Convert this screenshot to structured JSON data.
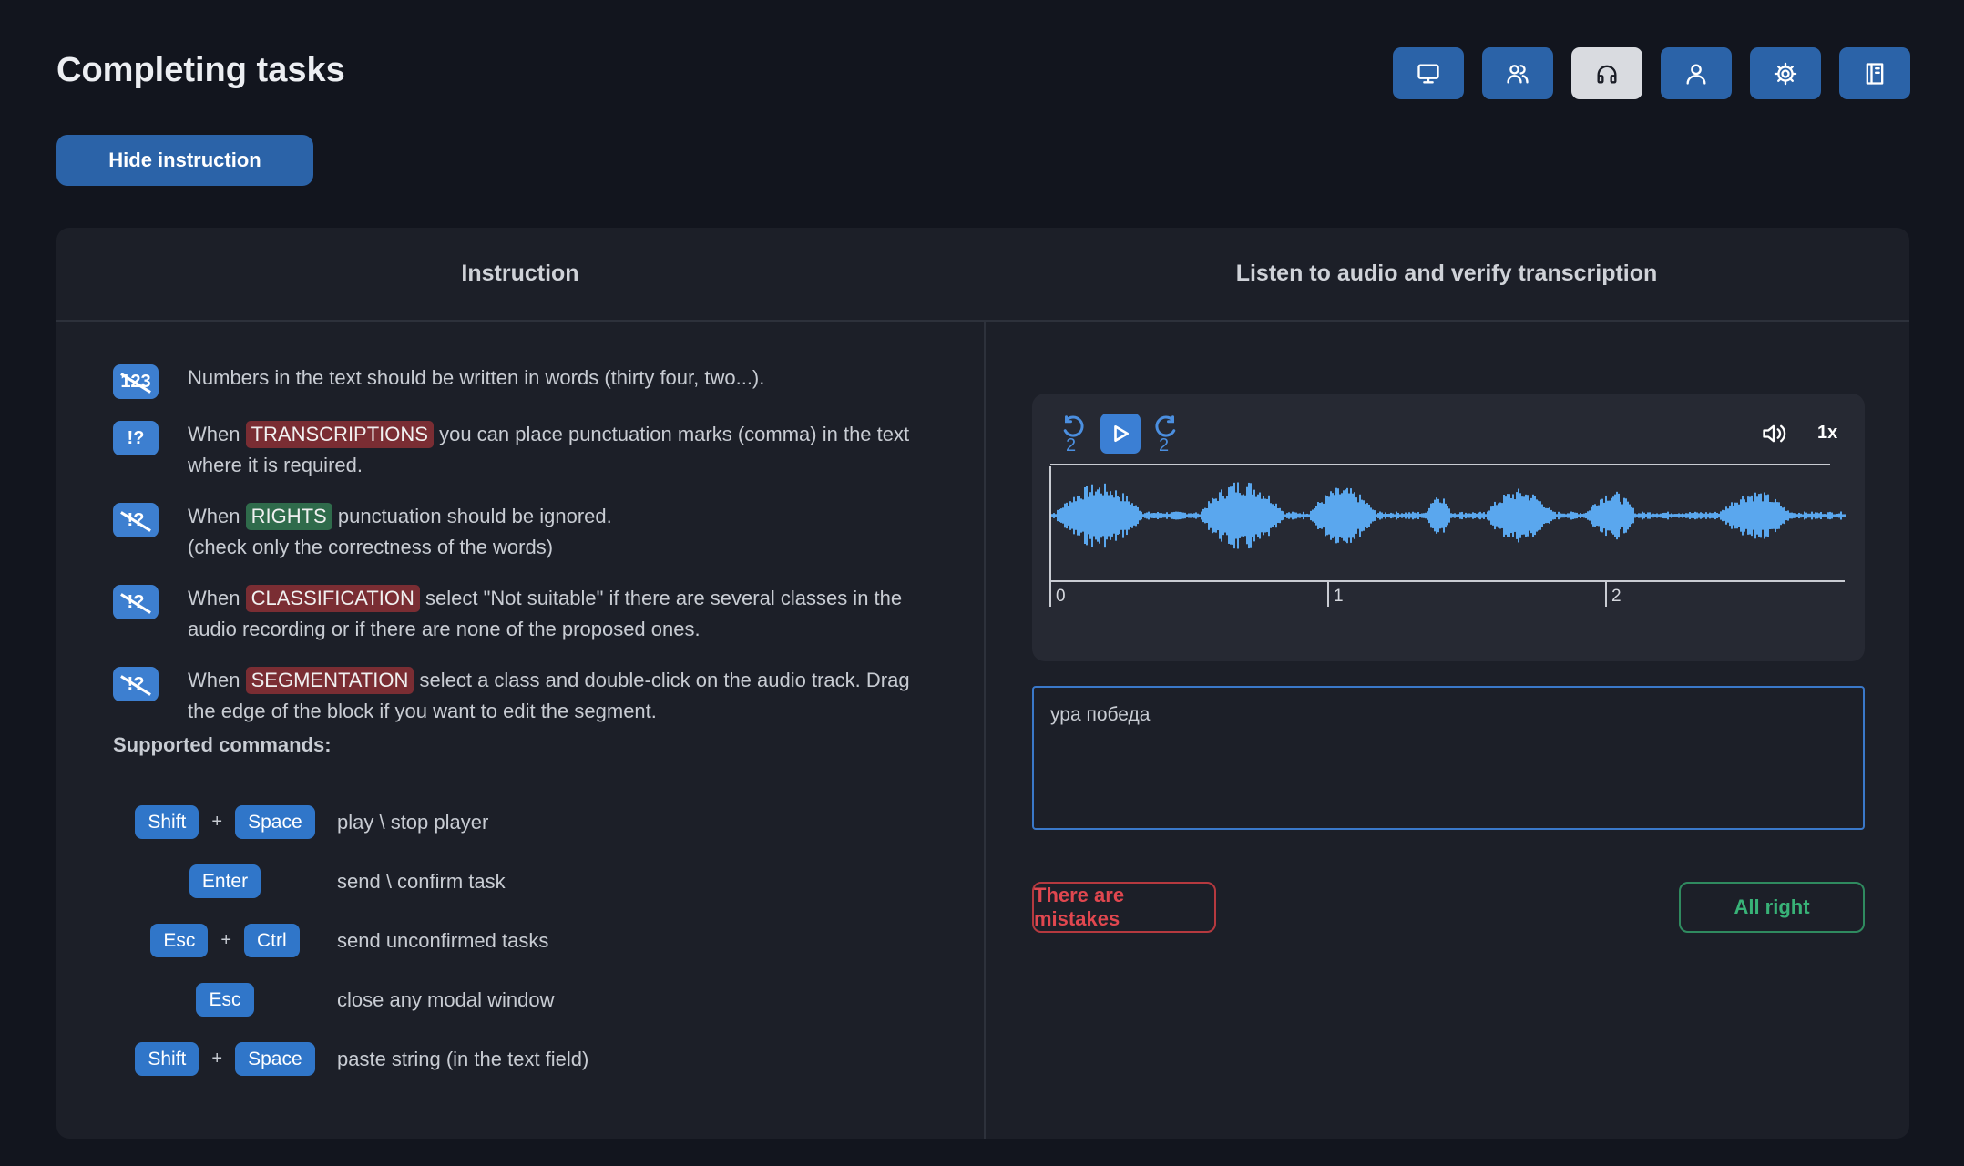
{
  "header": {
    "title": "Completing tasks",
    "nav": [
      {
        "icon": "monitor-icon",
        "active": false
      },
      {
        "icon": "users-icon",
        "active": false
      },
      {
        "icon": "headphones-icon",
        "active": true
      },
      {
        "icon": "user-icon",
        "active": false
      },
      {
        "icon": "gear-icon",
        "active": false
      },
      {
        "icon": "book-icon",
        "active": false
      }
    ],
    "hide_instruction": "Hide instruction"
  },
  "instruction": {
    "title": "Instruction",
    "rules": [
      {
        "icon_label": "123",
        "pre": "Numbers in the text should be written in words (thirty four, two...).",
        "tag": "",
        "post": "",
        "line2": ""
      },
      {
        "icon_label": "!?",
        "pre": "When",
        "tag": "TRANSCRIPTIONS",
        "post": "you can place punctuation marks (comma) in the text",
        "line2": "where it is required."
      },
      {
        "icon_label": "!?",
        "pre": "When",
        "tag": "RIGHTS",
        "post": "punctuation should be ignored.",
        "line2": "(check only the correctness of the words)"
      },
      {
        "icon_label": "!?",
        "pre": "When",
        "tag": "CLASSIFICATION",
        "post": "select \"Not suitable\" if there are several classes in the",
        "line2": "audio recording or if there are none of the proposed ones."
      },
      {
        "icon_label": "!?",
        "pre": "When",
        "tag": "SEGMENTATION",
        "post": "select a class and double-click on the audio track. Drag",
        "line2": "the edge of the block if you want to edit the segment."
      }
    ],
    "commands_title": "Supported commands:",
    "commands": [
      {
        "keys": [
          "Shift",
          "Space"
        ],
        "desc": "play \\ stop player"
      },
      {
        "keys": [
          "Enter"
        ],
        "desc": "send \\ confirm task"
      },
      {
        "keys": [
          "Esc",
          "Ctrl"
        ],
        "desc": "send unconfirmed tasks"
      },
      {
        "keys": [
          "Esc"
        ],
        "desc": "close any modal window"
      },
      {
        "keys": [
          "Shift",
          "Space"
        ],
        "desc": "paste string (in the text field)"
      }
    ],
    "plus": "+"
  },
  "task": {
    "title": "Listen to audio and verify transcription",
    "player": {
      "rewind_seconds": "2",
      "forward_seconds": "2",
      "speed": "1x",
      "timeline_ticks": [
        "0",
        "1",
        "2"
      ]
    },
    "transcription_value": "ура победа",
    "buttons": {
      "mistakes": "There are mistakes",
      "all_right": "All right"
    }
  },
  "colors": {
    "accent": "#2b63a8",
    "waveform": "#5aa7ee",
    "error": "#e0474f",
    "success": "#38b277"
  }
}
